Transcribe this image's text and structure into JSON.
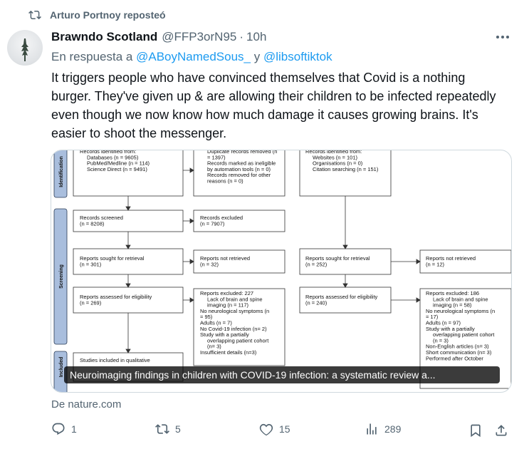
{
  "repost": {
    "label": "Arturo Portnoy reposteó"
  },
  "author": {
    "name": "Brawndo Scotland",
    "handle": "@FFP3orN95",
    "time": "10h"
  },
  "reply": {
    "prefix": "En respuesta a",
    "mention1": "@ABoyNamedSous_",
    "joiner": "y",
    "mention2": "@libsoftiktok"
  },
  "text": "It triggers people who have convinced themselves that Covid is a nothing burger. They've given up & are allowing their children to be infected repeatedly even though we now know how much damage it causes growing brains. It's easier to shoot the messenger.",
  "card": {
    "caption": "Neuroimaging findings in children with COVID-19 infection: a systematic review a...",
    "source": "De nature.com",
    "diagram": {
      "stages": [
        "Identification",
        "Screening",
        "Included"
      ],
      "ident_left": [
        "Records identified from:",
        "Databases (n = 9605)",
        "PubMed/Medline (n = 114)",
        "Science Direct (n = 9491)"
      ],
      "ident_mid": [
        "Duplicate records removed (n",
        "= 1397)",
        "Records marked as ineligible",
        "by automation tools (n = 0)",
        "Records removed for other",
        "reasons (n = 0)"
      ],
      "ident_right": [
        "Records identified from:",
        "Websites (n = 101)",
        "Organisations (n = 0)",
        "Citation searching (n = 151)"
      ],
      "screened": [
        "Records screened",
        "(n = 8208)"
      ],
      "excluded": [
        "Records excluded",
        "(n = 7907)"
      ],
      "sought_left": [
        "Reports sought for retrieval",
        "(n = 301)"
      ],
      "not_retrieved_left": [
        "Reports not retrieved",
        "(n = 32)"
      ],
      "sought_right": [
        "Reports sought for retrieval",
        "(n = 252)"
      ],
      "not_retrieved_right": [
        "Reports not retrieved",
        "(n = 12)"
      ],
      "assessed_left": [
        "Reports assessed for eligibility",
        "(n = 269)"
      ],
      "excluded_left": [
        "Reports excluded: 227",
        "Lack of brain and spine",
        "imaging (n = 117)",
        "No neurological symptoms (n",
        "= 95)",
        "Adults (n = 7)",
        "No Covid-19 infection (n= 2)",
        "Study with a partially",
        "overlapping patient cohort",
        "(n= 3)",
        "Insufficient details (n=3)"
      ],
      "assessed_right": [
        "Reports assessed for eligibility",
        "(n = 240)"
      ],
      "excluded_right": [
        "Reports excluded: 186",
        "Lack of brain and spine",
        "imaging (n = 58)",
        "No neurological symptoms (n",
        "= 17)",
        "Adults (n = 97)",
        "Study with a partially",
        "overlapping patient cohort",
        "(n = 3)",
        "Non-English articles (n= 3)",
        "Short communication (n= 3)",
        "Performed after October"
      ],
      "included": [
        "Studies included in qualitative"
      ]
    }
  },
  "actions": {
    "replies": "1",
    "reposts": "5",
    "likes": "15",
    "views": "289"
  }
}
